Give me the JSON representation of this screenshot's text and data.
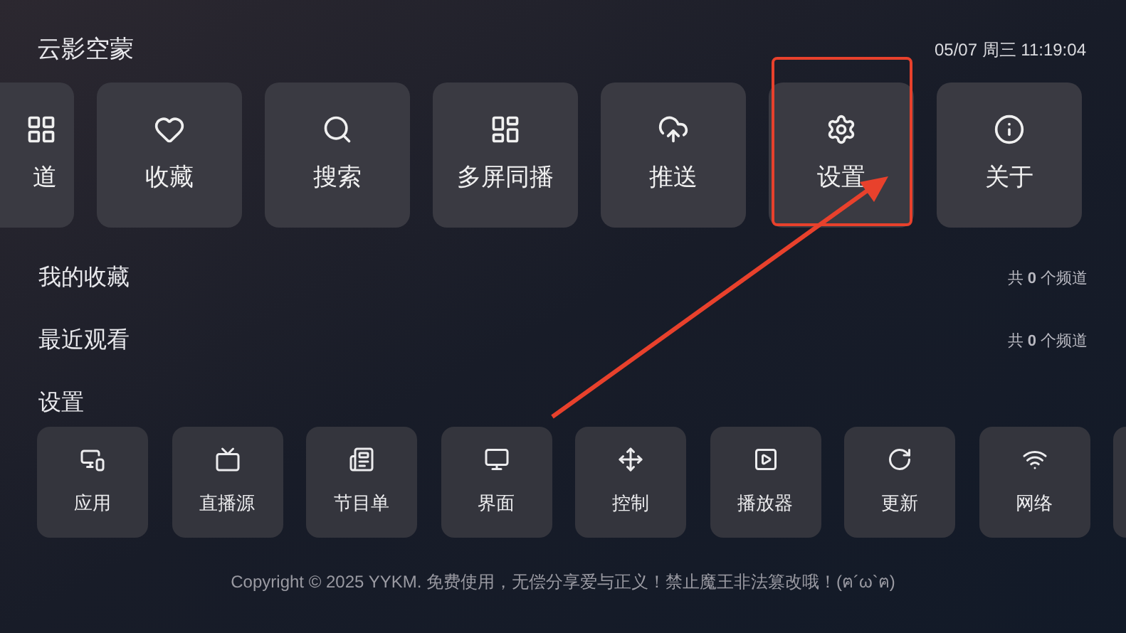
{
  "header": {
    "title": "云影空蒙",
    "datetime": "05/07 周三 11:19:04"
  },
  "top_tiles": [
    {
      "label": "道"
    },
    {
      "label": "收藏"
    },
    {
      "label": "搜索"
    },
    {
      "label": "多屏同播"
    },
    {
      "label": "推送"
    },
    {
      "label": "设置"
    },
    {
      "label": "关于"
    }
  ],
  "rows": [
    {
      "title": "我的收藏",
      "count": "共 **0** 个频道"
    },
    {
      "title": "最近观看",
      "count": "共 **0** 个频道"
    }
  ],
  "settings": {
    "title": "设置",
    "tiles": [
      {
        "label": "应用"
      },
      {
        "label": "直播源"
      },
      {
        "label": "节目单"
      },
      {
        "label": "界面"
      },
      {
        "label": "控制"
      },
      {
        "label": "播放器"
      },
      {
        "label": "更新"
      },
      {
        "label": "网络"
      }
    ]
  },
  "footer": "Copyright © 2025 YYKM. 免费使用，无偿分享爱与正义！禁止魔王非法篡改哦！(ฅ´ω`ฅ)"
}
